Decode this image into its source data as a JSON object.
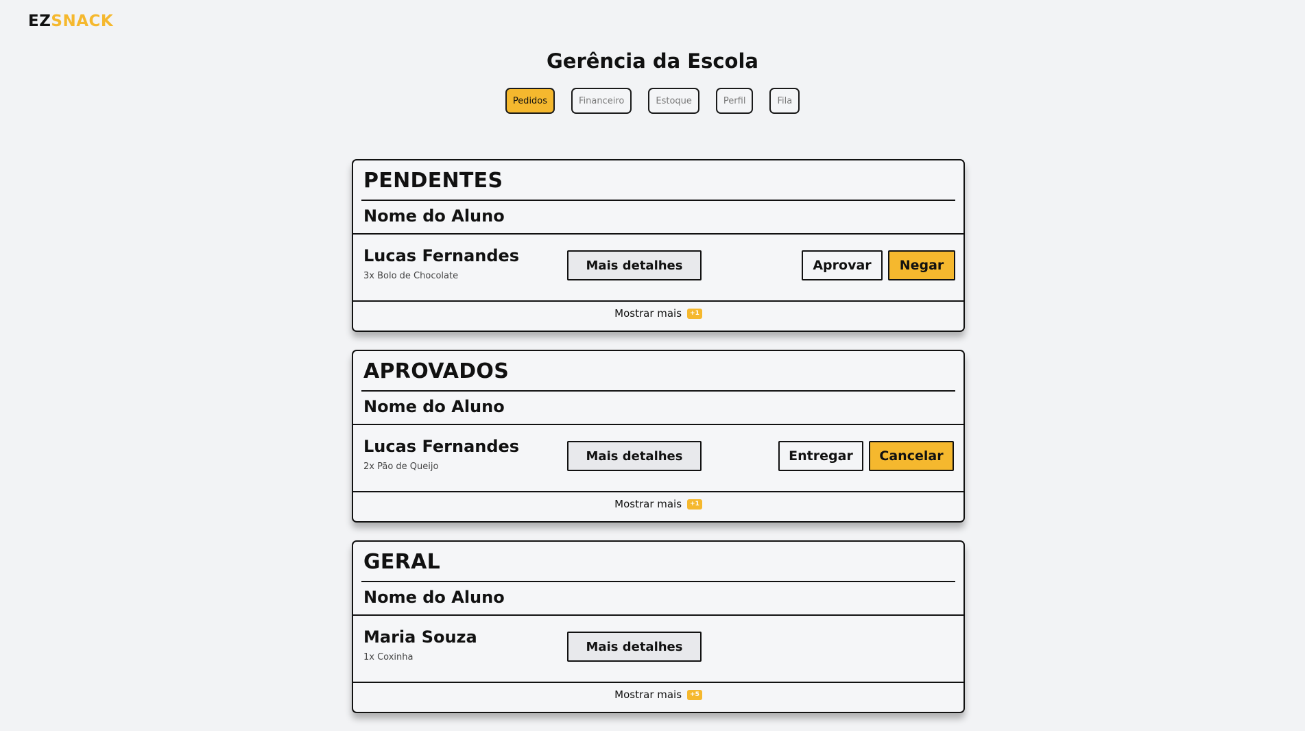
{
  "header": {
    "logo_ez": "EZ",
    "logo_snack": "SNACK",
    "title": "Gerência da Escola"
  },
  "tabs": [
    {
      "label": "Pedidos",
      "active": true
    },
    {
      "label": "Financeiro",
      "active": false
    },
    {
      "label": "Estoque",
      "active": false
    },
    {
      "label": "Perfil",
      "active": false
    },
    {
      "label": "Fila",
      "active": false
    }
  ],
  "colors": {
    "accent": "#f5b82e",
    "background": "#f2f3f5",
    "text": "#111111"
  },
  "sections": [
    {
      "title": "PENDENTES",
      "column_header": "Nome do Aluno",
      "order": {
        "student": "Lucas Fernandes",
        "items": "3x Bolo de Chocolate",
        "details_label": "Mais detalhes",
        "primary_action": "Aprovar",
        "secondary_action": "Negar"
      },
      "show_more_label": "Mostrar mais",
      "more_count": "+1"
    },
    {
      "title": "APROVADOS",
      "column_header": "Nome do Aluno",
      "order": {
        "student": "Lucas Fernandes",
        "items": "2x Pão de Queijo",
        "details_label": "Mais detalhes",
        "primary_action": "Entregar",
        "secondary_action": "Cancelar"
      },
      "show_more_label": "Mostrar mais",
      "more_count": "+1"
    },
    {
      "title": "GERAL",
      "column_header": "Nome do Aluno",
      "order": {
        "student": "Maria Souza",
        "items": "1x Coxinha",
        "details_label": "Mais detalhes"
      },
      "show_more_label": "Mostrar mais",
      "more_count": "+5"
    }
  ]
}
